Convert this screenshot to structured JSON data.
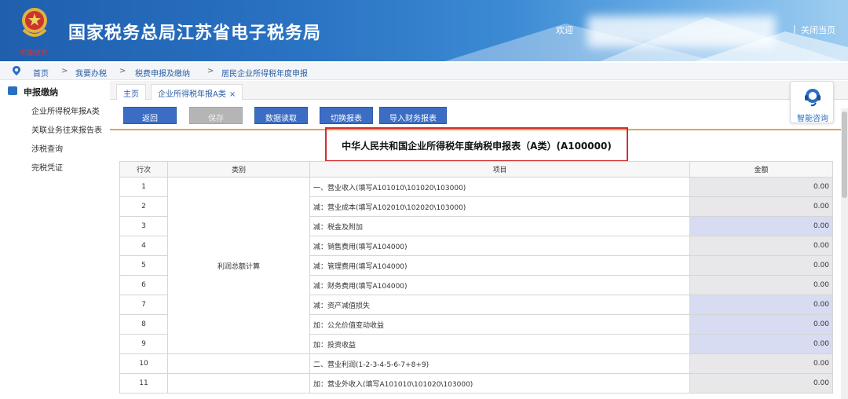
{
  "header": {
    "emblem_text": "中国税务",
    "site_title": "国家税务总局江苏省电子税务局",
    "welcome": "欢迎",
    "close_page": "关闭当页"
  },
  "breadcrumb": [
    "首页",
    "我要办税",
    "税费申报及缴纳",
    "居民企业所得税年度申报"
  ],
  "sidebar": {
    "head": "申报缴纳",
    "items": [
      "企业所得税年报A类",
      "关联业务往来报告表",
      "涉税查询",
      "完税凭证"
    ]
  },
  "tabs": [
    {
      "label": "主页"
    },
    {
      "label": "企业所得税年报A类",
      "close": "×"
    }
  ],
  "toolbar": {
    "back": "返回",
    "save": "保存",
    "read": "数据读取",
    "switch": "切换报表",
    "import": "导入财务报表"
  },
  "assistant": {
    "label": "智能咨询"
  },
  "form": {
    "title": "中华人民共和国企业所得税年度纳税申报表（A类）(A100000)",
    "columns": [
      "行次",
      "类别",
      "项目",
      "金额"
    ],
    "category": "利润总额计算",
    "rows": [
      {
        "no": "1",
        "item": "一、营业收入(填写A101010\\101020\\103000)",
        "amount": "0.00",
        "editable": false
      },
      {
        "no": "2",
        "item": "减：营业成本(填写A102010\\102020\\103000)",
        "amount": "0.00",
        "editable": false
      },
      {
        "no": "3",
        "item": "减：税金及附加",
        "amount": "0.00",
        "editable": true
      },
      {
        "no": "4",
        "item": "减：销售费用(填写A104000)",
        "amount": "0.00",
        "editable": false
      },
      {
        "no": "5",
        "item": "减：管理费用(填写A104000)",
        "amount": "0.00",
        "editable": false
      },
      {
        "no": "6",
        "item": "减：财务费用(填写A104000)",
        "amount": "0.00",
        "editable": false
      },
      {
        "no": "7",
        "item": "减：资产减值损失",
        "amount": "0.00",
        "editable": true
      },
      {
        "no": "8",
        "item": "加：公允价值变动收益",
        "amount": "0.00",
        "editable": true
      },
      {
        "no": "9",
        "item": "加：投资收益",
        "amount": "0.00",
        "editable": true
      },
      {
        "no": "10",
        "item": "二、营业利润(1-2-3-4-5-6-7+8+9)",
        "amount": "0.00",
        "editable": false
      },
      {
        "no": "11",
        "item": "加：营业外收入(填写A101010\\101020\\103000)",
        "amount": "0.00",
        "editable": false
      }
    ]
  }
}
